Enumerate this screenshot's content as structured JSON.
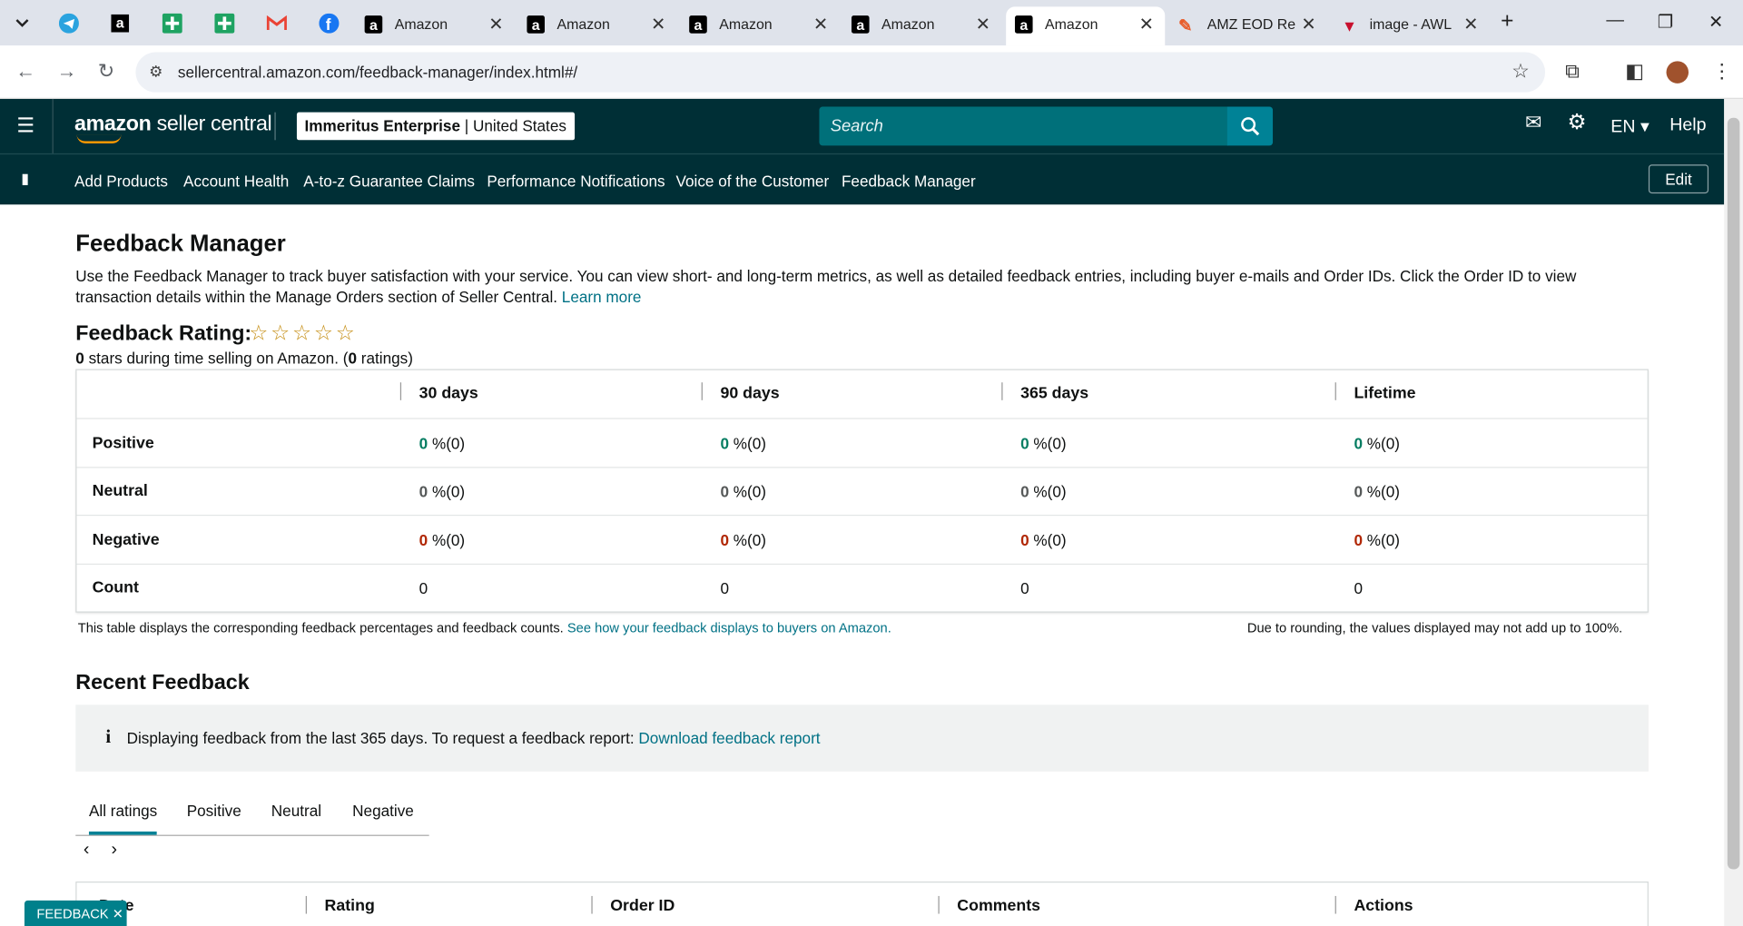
{
  "browser": {
    "tabs": [
      {
        "title": "Amazon"
      },
      {
        "title": "Amazon"
      },
      {
        "title": "Amazon"
      },
      {
        "title": "Amazon"
      },
      {
        "title": "Amazon"
      },
      {
        "title": "AMZ EOD Re"
      },
      {
        "title": "image - AWL"
      }
    ],
    "url": "sellercentral.amazon.com/feedback-manager/index.html#/"
  },
  "header": {
    "logo_bold": "amazon",
    "logo_rest": " seller central",
    "account_name": "Immeritus Enterprise",
    "account_region": "United States",
    "search_placeholder": "Search",
    "language": "EN",
    "help": "Help"
  },
  "subnav": {
    "items": [
      "Add Products",
      "Account Health",
      "A-to-z Guarantee Claims",
      "Performance Notifications",
      "Voice of the Customer",
      "Feedback Manager"
    ],
    "edit": "Edit"
  },
  "page": {
    "title": "Feedback Manager",
    "description": "Use the Feedback Manager to track buyer satisfaction with your service. You can view short- and long-term metrics, as well as detailed feedback entries, including buyer e-mails and Order IDs. Click the Order ID to view transaction details within the Manage Orders section of Seller Central.",
    "learn_more": "Learn more",
    "rating_label": "Feedback Rating:",
    "rating_stars": "0",
    "rating_text": "stars during time selling on Amazon. (",
    "rating_count": "0",
    "rating_text_end": "ratings)",
    "table": {
      "columns": [
        "30 days",
        "90 days",
        "365 days",
        "Lifetime"
      ],
      "rows": [
        {
          "label": "Positive",
          "values": [
            "0",
            "0",
            "0",
            "0"
          ],
          "suffix": "%(0)"
        },
        {
          "label": "Neutral",
          "values": [
            "0",
            "0",
            "0",
            "0"
          ],
          "suffix": "%(0)"
        },
        {
          "label": "Negative",
          "values": [
            "0",
            "0",
            "0",
            "0"
          ],
          "suffix": "%(0)"
        },
        {
          "label": "Count",
          "values": [
            "0",
            "0",
            "0",
            "0"
          ]
        }
      ]
    },
    "note_left": "This table displays the corresponding feedback percentages and feedback counts.",
    "note_link": "See how your feedback displays to buyers on Amazon.",
    "note_right": "Due to rounding, the values displayed may not add up to 100%.",
    "recent_title": "Recent Feedback",
    "info_text": "Displaying feedback from the last 365 days. To request a feedback report:",
    "info_link": "Download feedback report",
    "filter_tabs": [
      "All ratings",
      "Positive",
      "Neutral",
      "Negative"
    ],
    "feedback_columns": [
      "Date",
      "Rating",
      "Order ID",
      "Comments",
      "Actions"
    ],
    "feedback_widget": "FEEDBACK"
  }
}
